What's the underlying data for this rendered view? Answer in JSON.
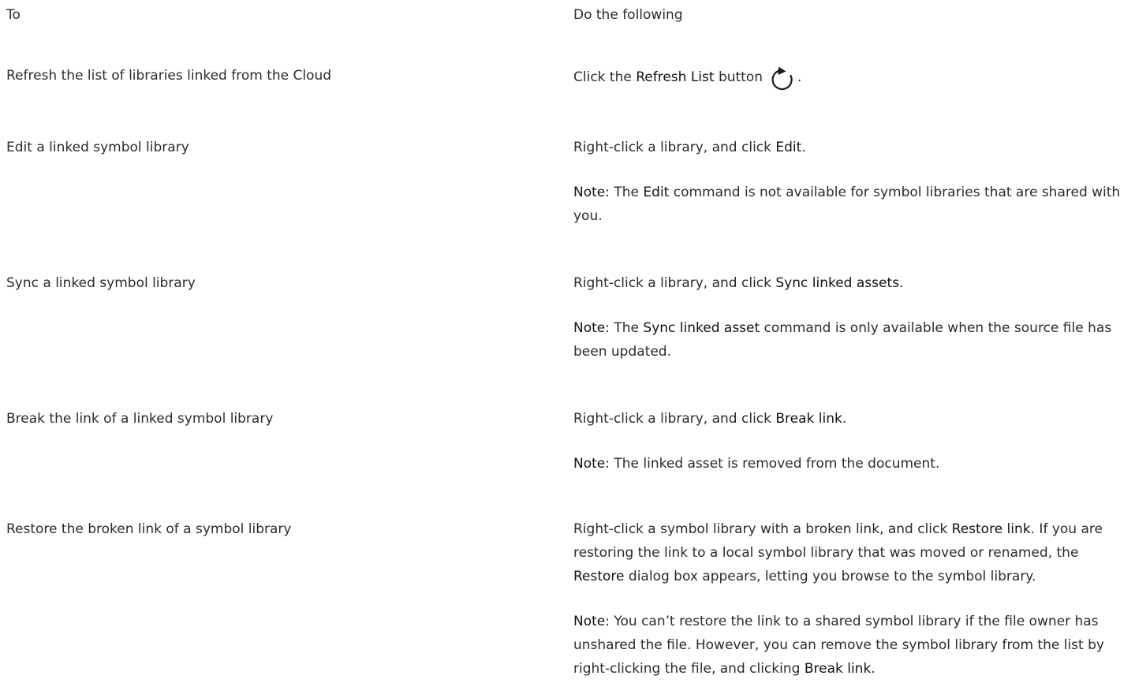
{
  "header": {
    "col_to": "To",
    "col_do": "Do the following"
  },
  "rows": [
    {
      "task": "Refresh the list of libraries linked from the Cloud",
      "action": {
        "pre": "Click the ",
        "bold": "Refresh List",
        "post": " button",
        "icon": "refresh-icon",
        "end": "."
      }
    },
    {
      "task": "Edit a linked symbol library",
      "action": {
        "pre": "Right-click a library, and click ",
        "bold": "Edit",
        "post": "."
      },
      "note": {
        "label": "Note",
        "pre": ": The ",
        "bold": "Edit",
        "post": " command is not available for symbol libraries that are shared with you."
      }
    },
    {
      "task": "Sync a linked symbol library",
      "action": {
        "pre": "Right-click a library, and click ",
        "bold": "Sync linked assets",
        "post": "."
      },
      "note": {
        "label": "Note",
        "pre": ": The ",
        "bold": "Sync linked asset",
        "post": " command is only available when the source file has been updated."
      }
    },
    {
      "task": "Break the link of a linked symbol library",
      "action": {
        "pre": "Right-click a library, and click ",
        "bold": "Break link",
        "post": "."
      },
      "note": {
        "label": "Note",
        "text": ": The linked asset is removed from the document."
      }
    },
    {
      "task": "Restore the broken link of a symbol library",
      "action": {
        "pre": "Right-click a symbol library with a broken link, and click ",
        "bold": "Restore link",
        "mid": ". If you are restoring the link to a local symbol library that was moved or renamed, the ",
        "bold2": "Restore",
        "post": " dialog box appears, letting you browse to the symbol library."
      },
      "note": {
        "label": "Note",
        "pre": ": You can’t restore the link to a shared symbol library if the file owner has unshared the file. However, you can remove the symbol library from the list by right-clicking the file, and clicking ",
        "bold": "Break link",
        "post": "."
      }
    }
  ]
}
